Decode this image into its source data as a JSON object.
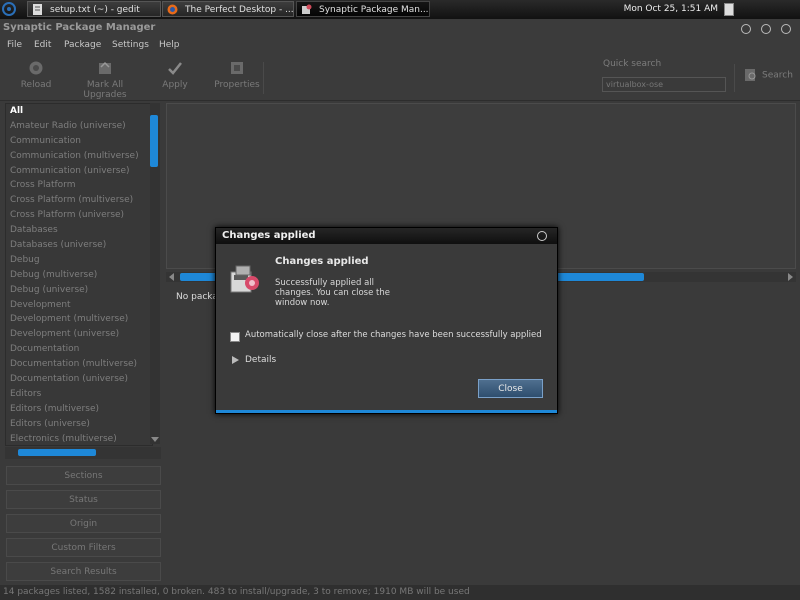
{
  "panel": {
    "tasks": [
      {
        "label": "setup.txt (~) - gedit"
      },
      {
        "label": "The Perfect Desktop - ..."
      },
      {
        "label": "Synaptic Package Man..."
      }
    ],
    "clock": "Mon Oct 25,  1:51 AM"
  },
  "window": {
    "title": "Synaptic Package Manager"
  },
  "menu": [
    "File",
    "Edit",
    "Package",
    "Settings",
    "Help"
  ],
  "toolbar": {
    "reload": "Reload",
    "mark_all": "Mark All Upgrades",
    "apply": "Apply",
    "properties": "Properties",
    "quick_search_label": "Quick search",
    "quick_search_value": "virtualbox-ose",
    "search": "Search"
  },
  "sections": [
    "All",
    "Amateur Radio (universe)",
    "Communication",
    "Communication (multiverse)",
    "Communication (universe)",
    "Cross Platform",
    "Cross Platform (multiverse)",
    "Cross Platform (universe)",
    "Databases",
    "Databases (universe)",
    "Debug",
    "Debug (multiverse)",
    "Debug (universe)",
    "Development",
    "Development (multiverse)",
    "Development (universe)",
    "Documentation",
    "Documentation (multiverse)",
    "Documentation (universe)",
    "Editors",
    "Editors (multiverse)",
    "Editors (universe)",
    "Electronics (multiverse)"
  ],
  "filters": [
    "Sections",
    "Status",
    "Origin",
    "Custom Filters",
    "Search Results"
  ],
  "pkg_area": {
    "no_package": "No packa"
  },
  "status": "14 packages listed, 1582 installed, 0 broken. 483 to install/upgrade, 3 to remove; 1910 MB will be used",
  "dialog": {
    "title": "Changes applied",
    "heading": "Changes applied",
    "message": "Successfully applied all changes. You can close the window now.",
    "checkbox": "Automatically close after the changes have been successfully applied",
    "details": "Details",
    "close": "Close"
  },
  "colors": {
    "accent": "#1e88d8",
    "background": "#3a3a3a"
  }
}
